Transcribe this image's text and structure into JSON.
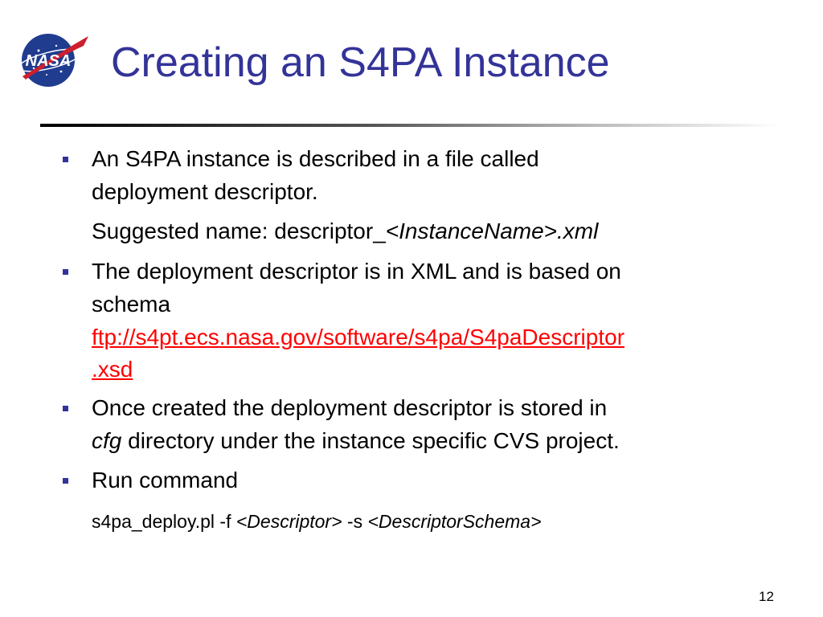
{
  "slide": {
    "title": "Creating an S4PA Instance",
    "page_number": "12",
    "logo_text": "NASA"
  },
  "bullets": [
    {
      "line1": "An S4PA instance is described in a file called",
      "line2": "deployment descriptor.",
      "sub": {
        "prefix": "Suggested name: descriptor_",
        "italic": "<InstanceName>.xml"
      }
    },
    {
      "line1": "The deployment descriptor is in XML and is based on",
      "line2": "schema",
      "link_line1": "ftp://s4pt.ecs.nasa.gov/software/s4pa/S4paDescriptor",
      "link_line2": ".xsd"
    },
    {
      "line1": "Once created the deployment descriptor is stored in",
      "line2_italic": "cfg",
      "line2_rest": " directory under the instance specific CVS project."
    },
    {
      "line1": "Run command",
      "cmd_part1": "s4pa_deploy.pl -f ",
      "cmd_italic1": "<Descriptor>",
      "cmd_part2": " -s ",
      "cmd_italic2": "<DescriptorSchema>"
    }
  ],
  "colors": {
    "title": "#333399",
    "bullet": "#333399",
    "link": "#ff0000",
    "logo_blue": "#1f3c8f"
  }
}
